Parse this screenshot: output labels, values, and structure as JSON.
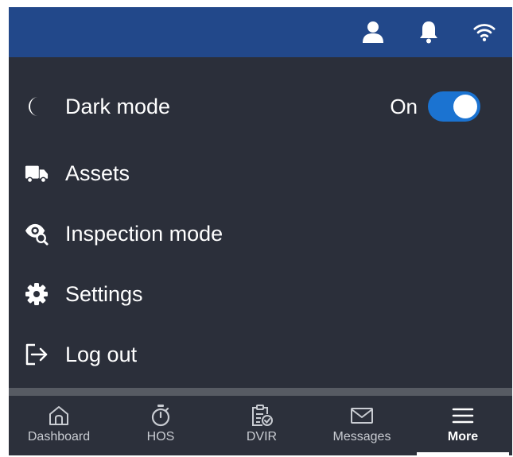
{
  "topbar": {
    "icons": [
      "user-icon",
      "bell-icon",
      "wifi-icon"
    ],
    "color": "#22488a"
  },
  "menu": {
    "items": [
      {
        "label": "Dark mode",
        "icon": "moon-icon",
        "toggle": {
          "state_label": "On",
          "on": true
        }
      },
      {
        "label": "Assets",
        "icon": "truck-icon"
      },
      {
        "label": "Inspection mode",
        "icon": "eye-search-icon"
      },
      {
        "label": "Settings",
        "icon": "gear-icon"
      },
      {
        "label": "Log out",
        "icon": "logout-icon"
      }
    ]
  },
  "bottom_nav": {
    "items": [
      {
        "label": "Dashboard",
        "icon": "home-icon"
      },
      {
        "label": "HOS",
        "icon": "stopwatch-icon"
      },
      {
        "label": "DVIR",
        "icon": "clipboard-check-icon"
      },
      {
        "label": "Messages",
        "icon": "envelope-icon"
      },
      {
        "label": "More",
        "icon": "hamburger-icon",
        "active": true
      }
    ]
  },
  "colors": {
    "background": "#2c303b",
    "accent": "#1b73d1",
    "text": "#ffffff"
  }
}
